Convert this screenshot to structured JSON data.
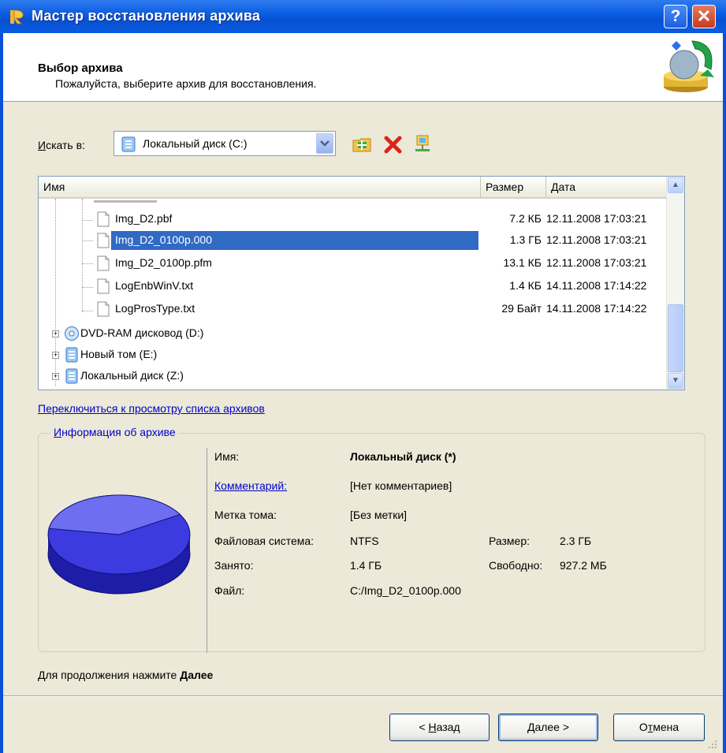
{
  "window": {
    "title": "Мастер восстановления архива",
    "help_glyph": "?",
    "close_glyph": "✕"
  },
  "header": {
    "title": "Выбор архива",
    "subtitle": "Пожалуйста, выберите архив для восстановления."
  },
  "lookin": {
    "label_hotkey": "И",
    "label_rest": "скать в:",
    "value": "Локальный диск (C:)"
  },
  "filelist": {
    "columns": [
      "Имя",
      "Размер",
      "Дата"
    ],
    "rows": [
      {
        "name": "Img_D2.pbf",
        "size": "7.2 КБ",
        "date": "12.11.2008 17:03:21"
      },
      {
        "name": "Img_D2_0100p.000",
        "size": "1.3 ГБ",
        "date": "12.11.2008 17:03:21",
        "selected": true
      },
      {
        "name": "Img_D2_0100p.pfm",
        "size": "13.1 КБ",
        "date": "12.11.2008 17:03:21"
      },
      {
        "name": "LogEnbWinV.txt",
        "size": "1.4 КБ",
        "date": "14.11.2008 17:14:22"
      },
      {
        "name": "LogProsType.txt",
        "size": "29 Байт",
        "date": "14.11.2008 17:14:22"
      }
    ],
    "drives": [
      {
        "name": "DVD-RAM дисковод (D:)",
        "icon": "dvd-drive-icon"
      },
      {
        "name": "Новый том (E:)",
        "icon": "hard-drive-icon"
      },
      {
        "name": "Локальный диск (Z:)",
        "icon": "hard-drive-icon"
      }
    ]
  },
  "switch_link": "Переключиться к просмотру списка архивов",
  "info": {
    "legend_hotkey": "И",
    "legend_rest": "нформация об архиве",
    "name_label": "Имя:",
    "name_value": "Локальный диск (*)",
    "comment_label": "Комментарий:",
    "comment_value": "[Нет комментариев]",
    "volume_label": "Метка тома:",
    "volume_value": "[Без метки]",
    "fs_label": "Файловая система:",
    "fs_value": "NTFS",
    "size_label": "Размер:",
    "size_value": "2.3 ГБ",
    "used_label": "Занято:",
    "used_value": "1.4 ГБ",
    "free_label": "Свободно:",
    "free_value": "927.2 МБ",
    "file_label": "Файл:",
    "file_value": "C:/Img_D2_0100p.000",
    "pie_used_fraction": 0.61
  },
  "hint": {
    "prefix": "Для продолжения нажмите ",
    "bold": "Далее"
  },
  "buttons": {
    "back": {
      "pre": "< ",
      "hotkey": "Н",
      "rest": "азад"
    },
    "next": {
      "hotkey": "Д",
      "rest": "алее >"
    },
    "cancel": {
      "pre": "О",
      "hotkey": "т",
      "rest": "мена"
    }
  },
  "colors": {
    "title_bar": "#0A5BE0",
    "selection": "#316AC5",
    "link": "#0000CC",
    "pie": "#3B3BE0"
  }
}
